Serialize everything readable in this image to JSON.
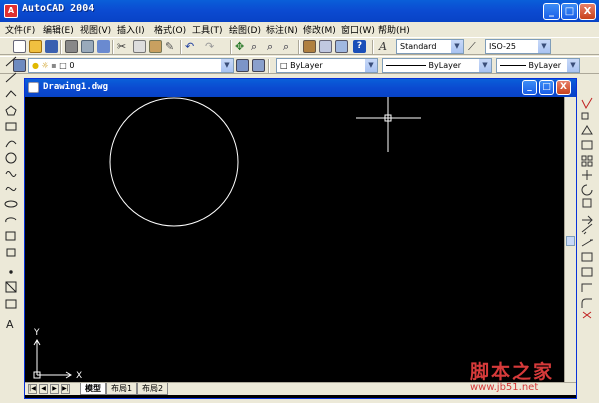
{
  "app": {
    "title": "AutoCAD 2004",
    "icon_letter": "A",
    "window_buttons": {
      "minimize": "_",
      "maximize": "□",
      "close": "X"
    }
  },
  "menu": [
    {
      "label": "文件(F)"
    },
    {
      "label": "编辑(E)"
    },
    {
      "label": "视图(V)"
    },
    {
      "label": "插入(I)"
    },
    {
      "label": "格式(O)"
    },
    {
      "label": "工具(T)"
    },
    {
      "label": "绘图(D)"
    },
    {
      "label": "标注(N)"
    },
    {
      "label": "修改(M)"
    },
    {
      "label": "窗口(W)"
    },
    {
      "label": "帮助(H)"
    }
  ],
  "styles_toolbar": {
    "text_style": "Standard",
    "dim_style": "ISO-25"
  },
  "layers_toolbar": {
    "current_layer": "0",
    "color": "ByLayer",
    "linetype": "ByLayer",
    "lineweight": "ByLayer"
  },
  "drawing": {
    "title": "Drawing1.dwg",
    "ucs": {
      "y_label": "Y",
      "x_label": "X"
    },
    "circle": {
      "stroke": "#ffffff"
    },
    "crosshair": {
      "color": "#ffffff"
    }
  },
  "layout_tabs": [
    {
      "label": "模型",
      "active": true
    },
    {
      "label": "布局1",
      "active": false
    },
    {
      "label": "布局2",
      "active": false
    }
  ],
  "nav_buttons": [
    "|◀",
    "◀",
    "▶",
    "▶|"
  ],
  "watermark": {
    "main": "脚本之家",
    "url": "www.jb51.net"
  },
  "colors": {
    "titlebar": "#0b4ad1",
    "chrome": "#ece9d8",
    "canvas": "#000000",
    "watermark": "#d63a3a"
  }
}
